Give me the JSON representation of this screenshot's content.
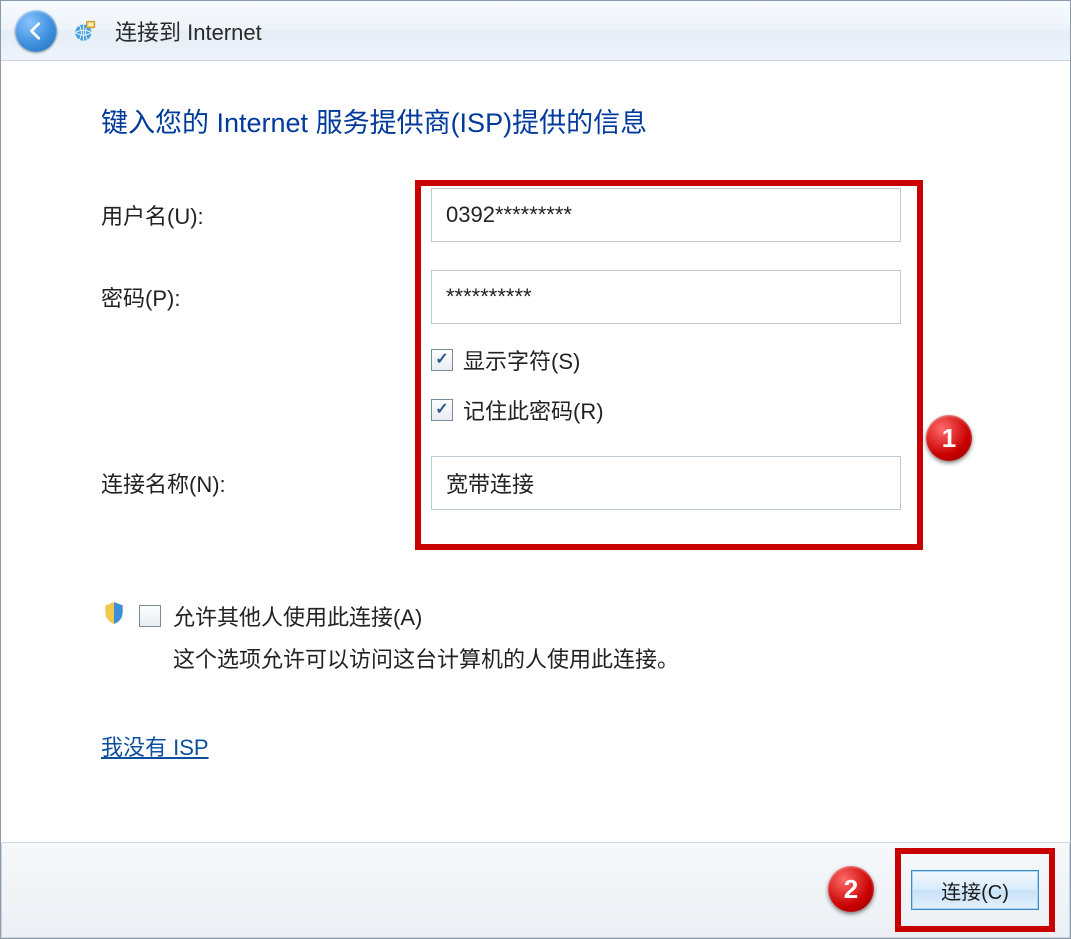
{
  "window": {
    "title": "连接到 Internet"
  },
  "heading": "键入您的 Internet 服务提供商(ISP)提供的信息",
  "form": {
    "username_label": "用户名(U):",
    "username_value": "0392*********",
    "password_label": "密码(P):",
    "password_value": "**********",
    "show_chars_label": "显示字符(S)",
    "show_chars_checked": true,
    "remember_pwd_label": "记住此密码(R)",
    "remember_pwd_checked": true,
    "connection_name_label": "连接名称(N):",
    "connection_name_value": "宽带连接"
  },
  "allow": {
    "checkbox_label": "允许其他人使用此连接(A)",
    "checked": false,
    "description": "这个选项允许可以访问这台计算机的人使用此连接。"
  },
  "link_no_isp": "我没有 ISP",
  "footer": {
    "connect_label": "连接(C)"
  },
  "annotations": {
    "one": "1",
    "two": "2"
  }
}
